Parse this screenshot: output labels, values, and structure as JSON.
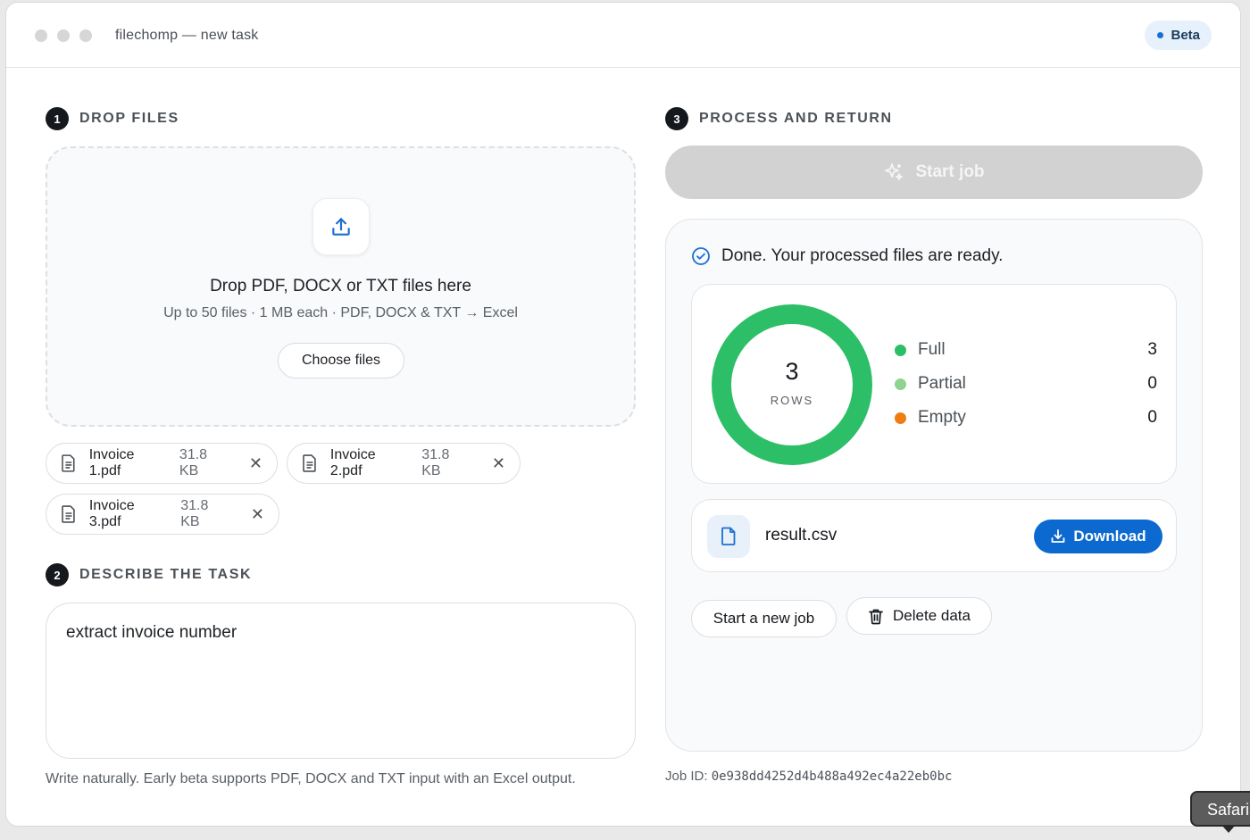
{
  "window": {
    "title": "filechomp — new task",
    "badge": "Beta",
    "accent_color": "#0b69cf"
  },
  "steps": [
    {
      "number": "1",
      "label": "DROP FILES"
    },
    {
      "number": "2",
      "label": "DESCRIBE THE TASK"
    },
    {
      "number": "3",
      "label": "PROCESS AND RETURN"
    }
  ],
  "dropzone": {
    "icon": "upload-icon",
    "title": "Drop PDF, DOCX or TXT files here",
    "subtitle": "Up to 50 files · 1 MB each · PDF, DOCX & TXT → Excel",
    "choose_label": "Choose files"
  },
  "files": [
    {
      "name": "Invoice 1.pdf",
      "size": "31.8 KB"
    },
    {
      "name": "Invoice 2.pdf",
      "size": "31.8 KB"
    },
    {
      "name": "Invoice 3.pdf",
      "size": "31.8 KB"
    }
  ],
  "task": {
    "value": "extract invoice number",
    "hint": "Write naturally. Early beta supports PDF, DOCX and TXT input with an Excel output."
  },
  "process": {
    "start_label": "Start job",
    "start_icon": "sparkles-icon",
    "status_text": "Done. Your processed files are ready.",
    "rows_count": "3",
    "rows_label": "ROWS",
    "legend": [
      {
        "name": "Full",
        "value": "3",
        "color": "#2cbf68"
      },
      {
        "name": "Partial",
        "value": "0",
        "color": "#8ed48f"
      },
      {
        "name": "Empty",
        "value": "0",
        "color": "#ef7d12"
      }
    ],
    "result_file": "result.csv",
    "download_label": "Download",
    "new_job_label": "Start a new job",
    "delete_label": "Delete data",
    "job_id_label": "Job ID:",
    "job_id": "0e938dd4252d4b488a492ec4a22eb0bc"
  },
  "tooltip": {
    "text": "Safari"
  }
}
